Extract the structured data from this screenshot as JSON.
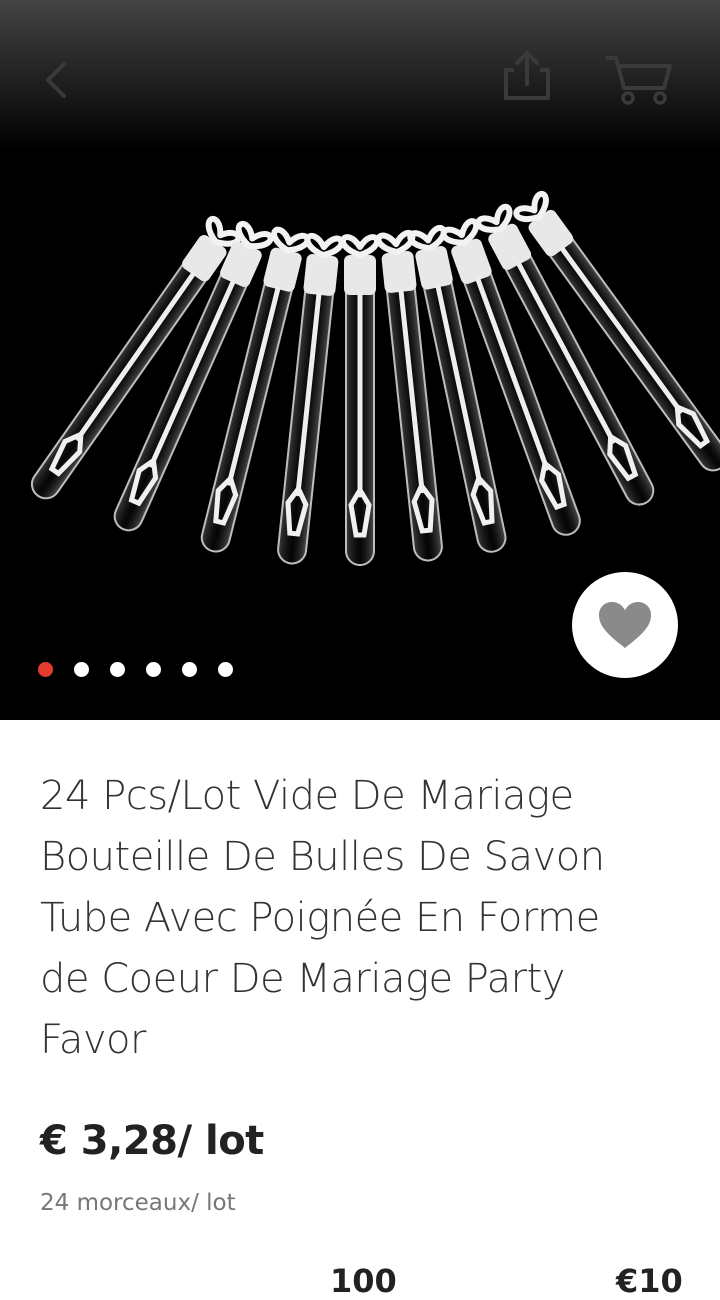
{
  "header": {
    "icons": [
      "back-chevron-icon",
      "share-icon",
      "cart-icon"
    ]
  },
  "gallery": {
    "image_description_icon": "bubble-wand-tubes-image",
    "slide_count": 6,
    "active_slide": 1,
    "active_dot_color": "#e53c2f",
    "favorite_icon": "heart-icon"
  },
  "product": {
    "title_lines": [
      "24 Pcs/Lot Vide De Mariage",
      "Bouteille De Bulles De Savon",
      "Tube Avec Poignée En Forme",
      "de Coeur De Mariage Party",
      "Favor"
    ],
    "price": "€ 3,28/ lot",
    "unit_info": "24 morceaux/ lot"
  },
  "cut_off": {
    "left_value": "100",
    "right_value": "€10"
  }
}
